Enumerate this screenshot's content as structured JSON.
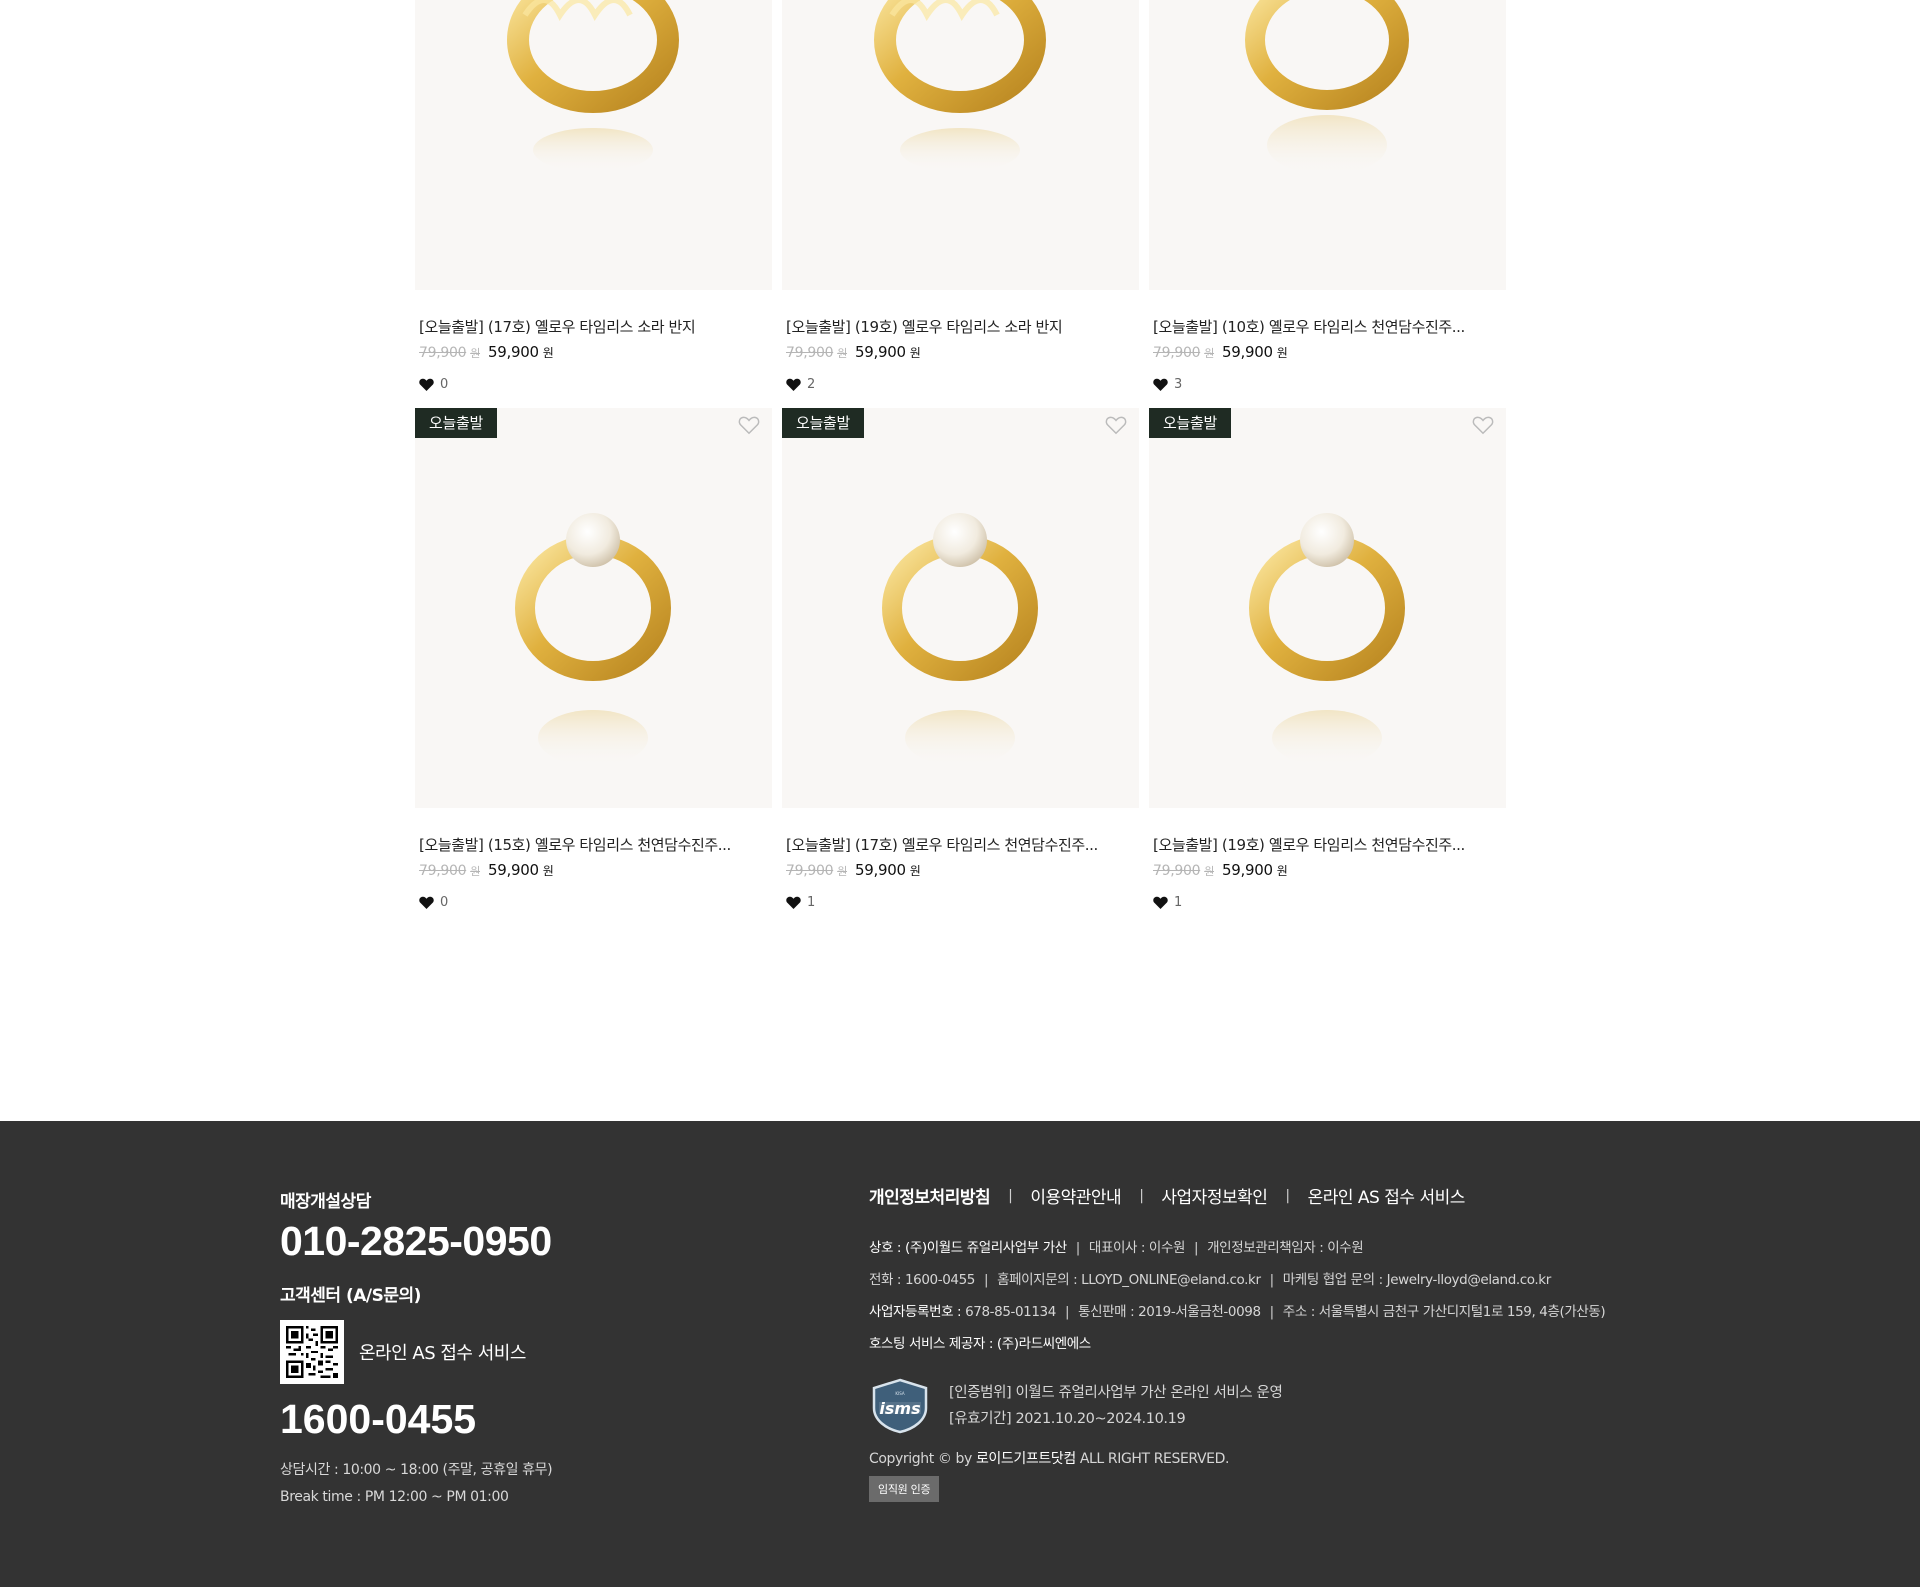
{
  "products_row1": [
    {
      "title": "[오늘출발] (17호) 옐로우 타임리스 소라 반지",
      "orig_price": "79,900",
      "price": "59,900",
      "likes": "0"
    },
    {
      "title": "[오늘출발] (19호) 옐로우 타임리스 소라 반지",
      "orig_price": "79,900",
      "price": "59,900",
      "likes": "2"
    },
    {
      "title": "[오늘출발] (10호) 옐로우 타임리스 천연담수진주...",
      "orig_price": "79,900",
      "price": "59,900",
      "likes": "3"
    }
  ],
  "products_row2": [
    {
      "badge": "오늘출발",
      "title": "[오늘출발] (15호) 옐로우 타임리스 천연담수진주...",
      "orig_price": "79,900",
      "price": "59,900",
      "likes": "0"
    },
    {
      "badge": "오늘출발",
      "title": "[오늘출발] (17호) 옐로우 타임리스 천연담수진주...",
      "orig_price": "79,900",
      "price": "59,900",
      "likes": "1"
    },
    {
      "badge": "오늘출발",
      "title": "[오늘출발] (19호) 옐로우 타임리스 천연담수진주...",
      "orig_price": "79,900",
      "price": "59,900",
      "likes": "1"
    }
  ],
  "currency_unit": "원",
  "footer": {
    "store_label": "매장개설상담",
    "store_phone": "010-2825-0950",
    "cs_label": "고객센터 (A/S문의)",
    "qr_text": "온라인 AS 접수 서비스",
    "cs_phone": "1600-0455",
    "hours": "상담시간  : 10:00 ~ 18:00 (주말, 공휴일 휴무)",
    "break": "Break time  : PM 12:00 ~ PM 01:00",
    "links": [
      "개인정보처리방침",
      "이용약관안내",
      "사업자정보확인",
      "온라인 AS 접수 서비스"
    ],
    "info": {
      "company_k": "상호 :",
      "company_v": "(주)이월드 쥬얼리사업부 가산",
      "ceo": "대표이사 : 이수원",
      "privacy": "개인정보관리책임자 : 이수원",
      "tel": "전화 : 1600-0455",
      "email": "홈페이지문의 : LLOYD_ONLINE@eland.co.kr",
      "marketing": "마케팅 협업 문의 : Jewelry-lloyd@eland.co.kr",
      "bizno_k": "사업자등록번호 :",
      "bizno_v": "678-85-01134",
      "mail_order": "통신판매 : 2019-서울금천-0098",
      "address": "주소 : 서울특별시 금천구 가산디지털1로 159, 4층(가산동)",
      "hosting_k": "호스팅 서비스 제공자 :",
      "hosting_v": "(주)라드씨엔에스"
    },
    "isms_scope": "[인증범위] 이월드 쥬얼리사업부 가산 온라인 서비스 운영",
    "isms_period": "[유효기간] 2021.10.20~2024.10.19",
    "copyright_prefix": "Copyright © by",
    "copyright_brand": "로이드기프트닷컴",
    "copyright_suffix": "ALL RIGHT RESERVED.",
    "verify_button": "임직원 인증"
  },
  "colors": {
    "badge_bg": "#1f2b23",
    "footer_bg": "#333333",
    "gold": "#e2b546"
  }
}
